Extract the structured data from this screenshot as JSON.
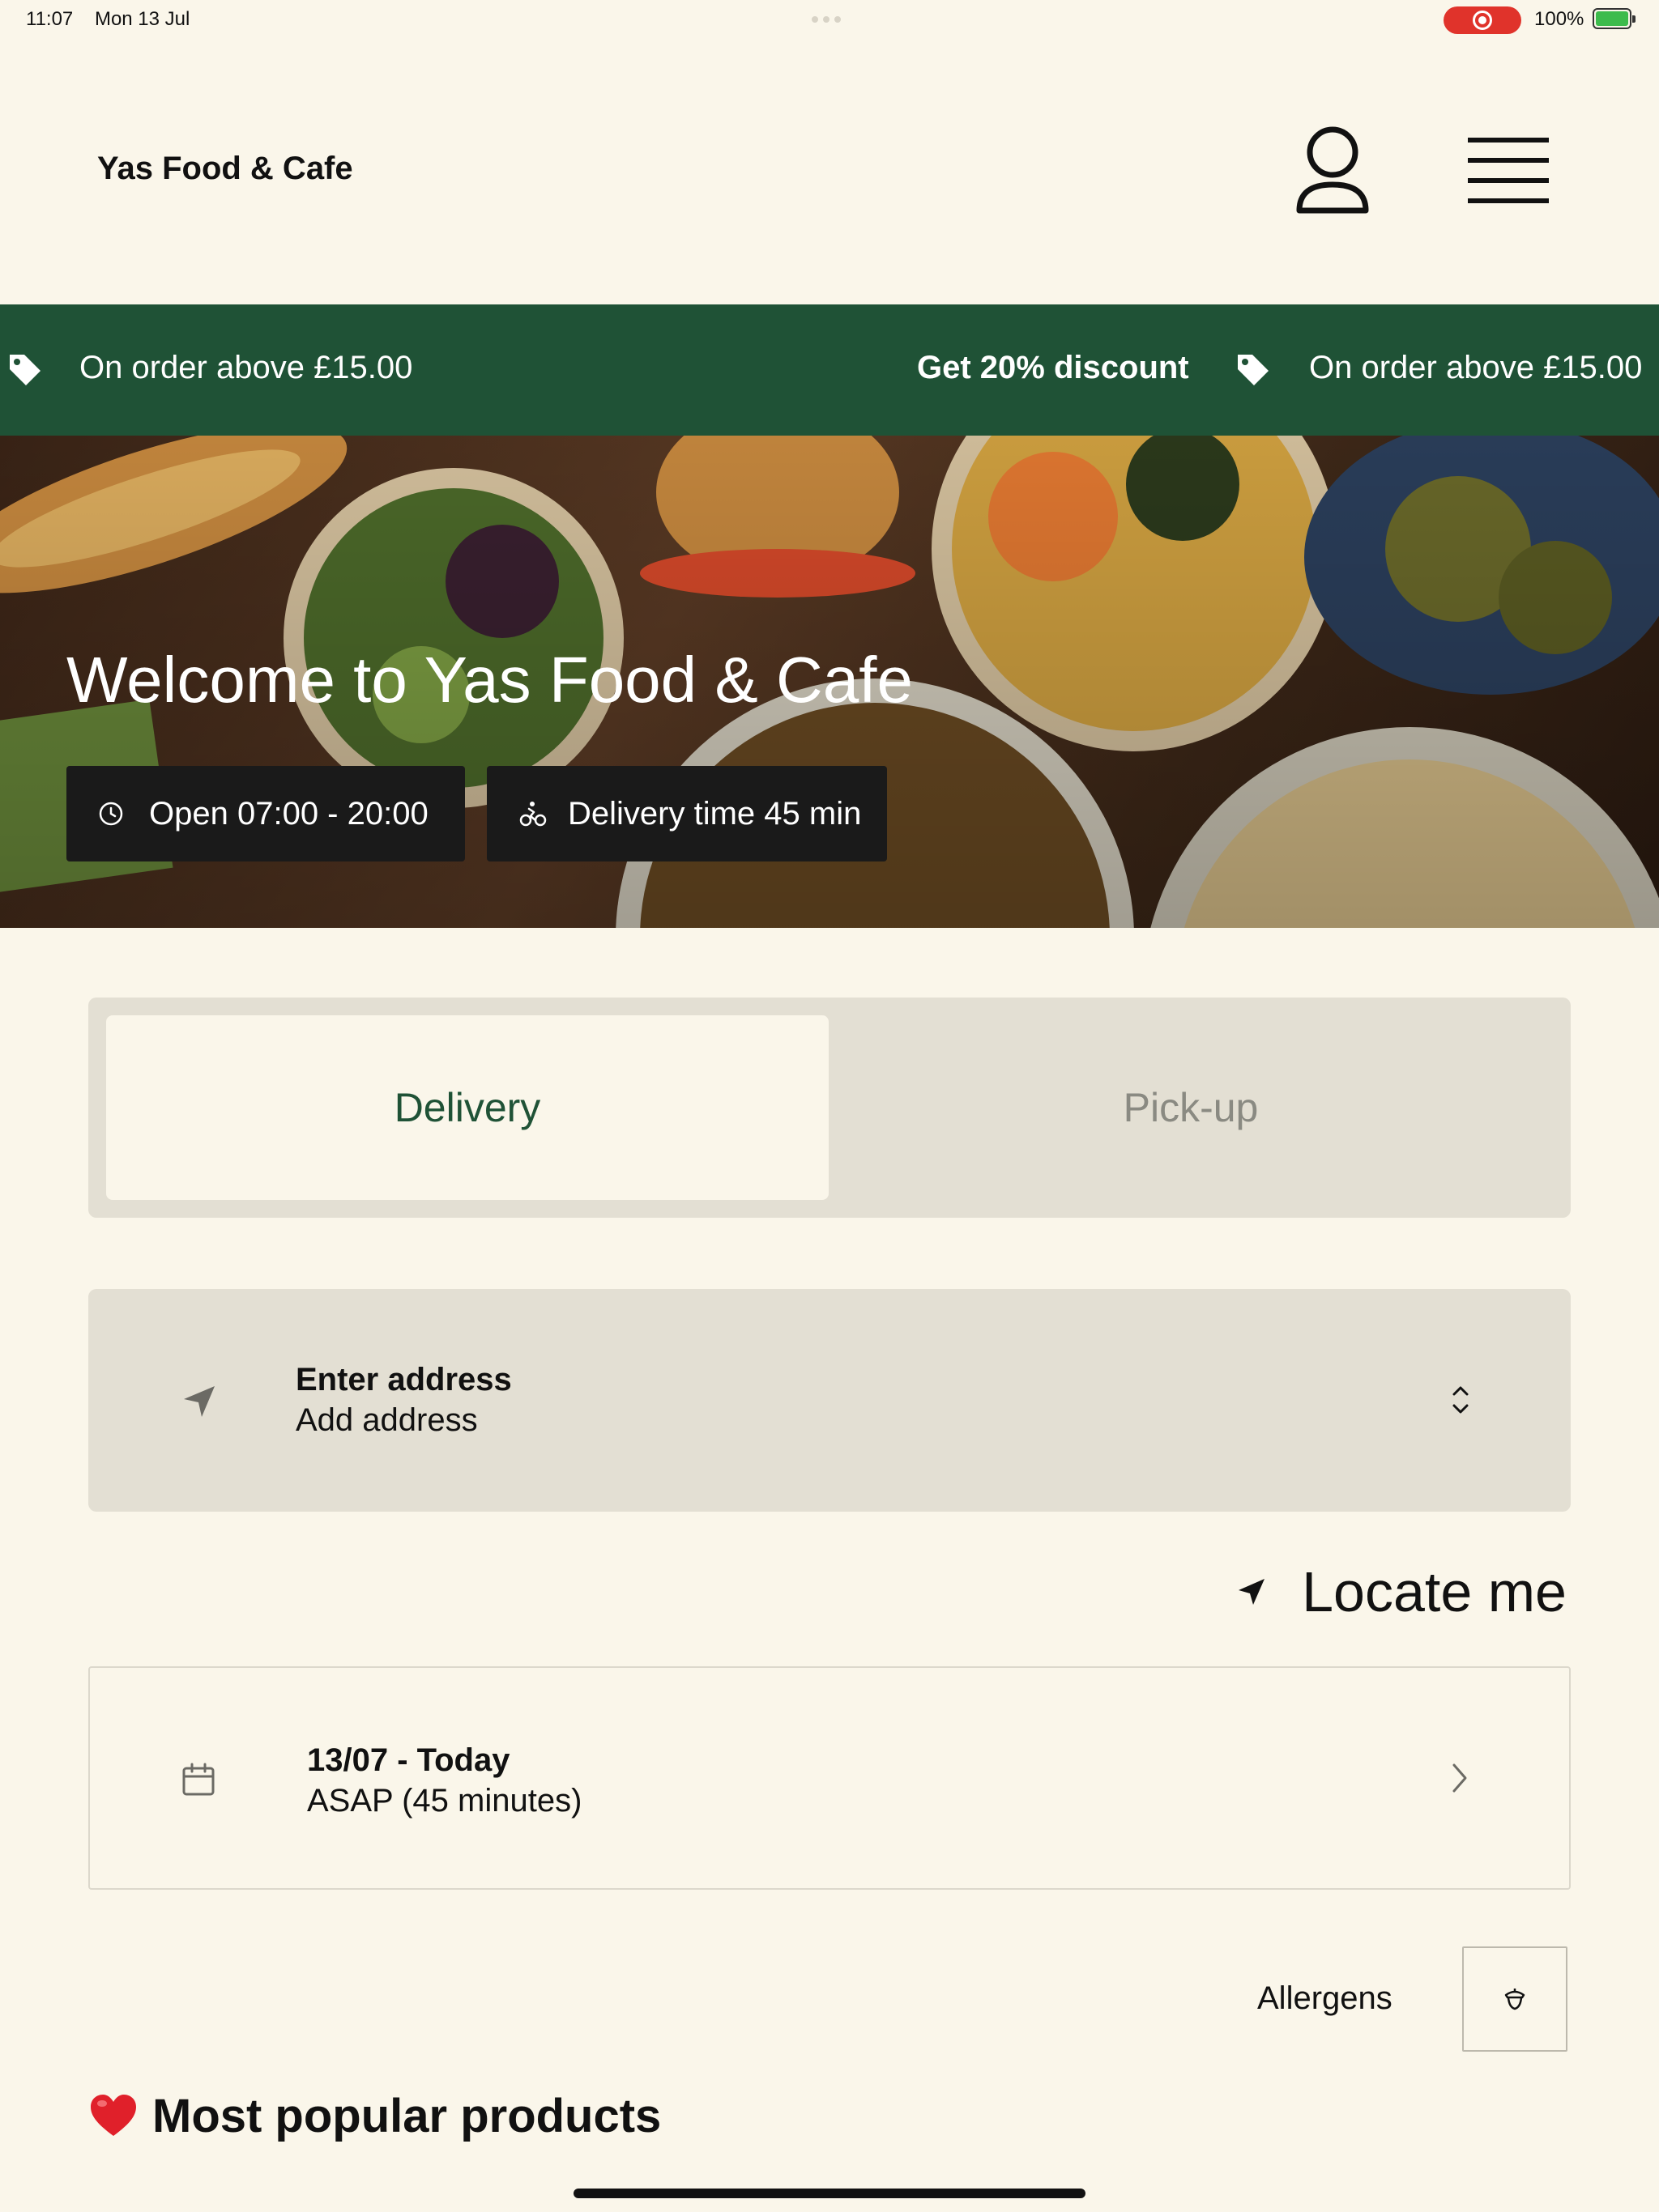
{
  "status_bar": {
    "time": "11:07",
    "date": "Mon 13 Jul",
    "battery": "100%"
  },
  "header": {
    "brand": "Yas Food & Cafe"
  },
  "promo": {
    "items": [
      "On order above £15.00",
      "Get 20% discount",
      "On order above £15.00"
    ],
    "background": "#1f5236"
  },
  "hero": {
    "title": "Welcome to Yas Food & Cafe",
    "open_hours": "Open 07:00 - 20:00",
    "delivery_time": "Delivery time 45 min"
  },
  "order_tabs": {
    "delivery": "Delivery",
    "pickup": "Pick-up",
    "selected": "Delivery"
  },
  "address": {
    "title": "Enter address",
    "subtitle": "Add address"
  },
  "locate": {
    "label": "Locate me"
  },
  "schedule": {
    "title": "13/07 - Today",
    "subtitle": "ASAP (45 minutes)"
  },
  "allergens": {
    "label": "Allergens"
  },
  "section": {
    "popular_title": "Most popular products"
  },
  "colors": {
    "accent": "#1f5236",
    "background": "#faf6ea",
    "panel": "#e3dfd3"
  }
}
